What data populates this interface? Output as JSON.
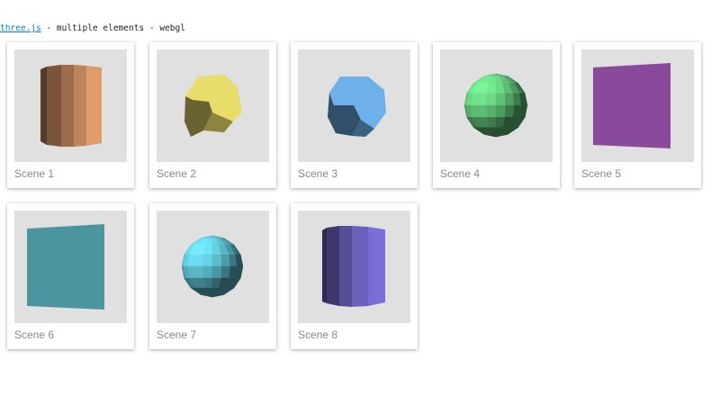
{
  "header": {
    "link_text": "three.js",
    "rest_text": " - multiple elements - webgl"
  },
  "scenes": [
    {
      "label": "Scene 1",
      "shape": "cylinder",
      "color": "#e09b6b"
    },
    {
      "label": "Scene 2",
      "shape": "dodecahedron",
      "color": "#e8dd6a"
    },
    {
      "label": "Scene 3",
      "shape": "dodecahedron",
      "color": "#6fb0ea"
    },
    {
      "label": "Scene 4",
      "shape": "sphere",
      "color": "#6ee08a"
    },
    {
      "label": "Scene 5",
      "shape": "plane",
      "color": "#a157b8"
    },
    {
      "label": "Scene 6",
      "shape": "plane",
      "color": "#5aafba"
    },
    {
      "label": "Scene 7",
      "shape": "sphere",
      "color": "#6ad9ec"
    },
    {
      "label": "Scene 8",
      "shape": "cylinder",
      "color": "#7a6ed6"
    }
  ]
}
